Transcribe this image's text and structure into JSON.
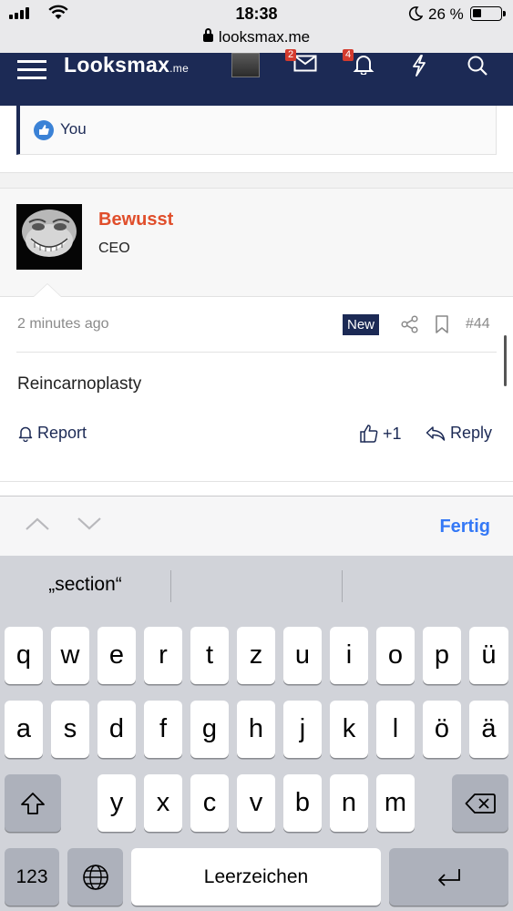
{
  "status_bar": {
    "time": "18:38",
    "url": "looksmax.me",
    "battery": "26 %"
  },
  "nav": {
    "logo": "Looksmax",
    "logo_suffix": ".me",
    "messages_badge": "2",
    "alerts_badge": "4"
  },
  "likes": {
    "text": "You"
  },
  "author": {
    "name": "Bewusst",
    "title": "CEO"
  },
  "post": {
    "time": "2 minutes ago",
    "badge": "New",
    "number": "#44",
    "body": "Reincarnoplasty",
    "report_label": "Report",
    "like_count": "+1",
    "reply_label": "Reply"
  },
  "accessory": {
    "done_label": "Fertig"
  },
  "keyboard": {
    "suggestion": "„section“",
    "row1": [
      "q",
      "w",
      "e",
      "r",
      "t",
      "z",
      "u",
      "i",
      "o",
      "p",
      "ü"
    ],
    "row2": [
      "a",
      "s",
      "d",
      "f",
      "g",
      "h",
      "j",
      "k",
      "l",
      "ö",
      "ä"
    ],
    "row3": [
      "y",
      "x",
      "c",
      "v",
      "b",
      "n",
      "m"
    ],
    "numbers_key": "123",
    "space_label": "Leerzeichen"
  }
}
